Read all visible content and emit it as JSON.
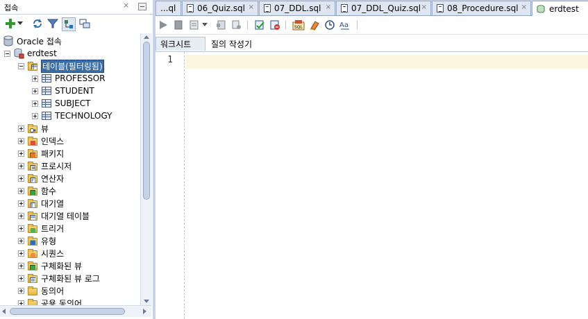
{
  "left_pane": {
    "title": "접속",
    "close_glyph": "×",
    "toolbar": [
      {
        "name": "add-connection-icon"
      },
      {
        "name": "dropdown-arrow-icon"
      },
      {
        "name": "refresh-icon"
      },
      {
        "name": "filter-icon"
      },
      {
        "name": "schema-browser-icon"
      },
      {
        "name": "manage-connections-icon"
      }
    ]
  },
  "tree": {
    "root": {
      "label": "Oracle 접속"
    },
    "connection": {
      "label": "erdtest"
    },
    "tables_folder": {
      "label": "테이블(필터링됨)"
    },
    "tables": [
      {
        "label": "PROFESSOR"
      },
      {
        "label": "STUDENT"
      },
      {
        "label": "SUBJECT"
      },
      {
        "label": "TECHNOLOGY"
      }
    ],
    "folders": [
      {
        "label": "뷰",
        "badge": "view"
      },
      {
        "label": "인덱스",
        "badge": "index"
      },
      {
        "label": "패키지",
        "badge": "package"
      },
      {
        "label": "프로시저",
        "badge": "procedure"
      },
      {
        "label": "연산자",
        "badge": "operator"
      },
      {
        "label": "함수",
        "badge": "function"
      },
      {
        "label": "대기열",
        "badge": "queue"
      },
      {
        "label": "대기열 테이블",
        "badge": "queue-table"
      },
      {
        "label": "트리거",
        "badge": "trigger"
      },
      {
        "label": "유형",
        "badge": "type"
      },
      {
        "label": "시퀀스",
        "badge": "sequence"
      },
      {
        "label": "구체화된 뷰",
        "badge": "mview"
      },
      {
        "label": "구체화된 뷰 로그",
        "badge": "mview-log"
      },
      {
        "label": "동의어",
        "badge": "synonym"
      },
      {
        "label": "공용 동의어",
        "badge": "public-synonym"
      }
    ]
  },
  "editor_tabs": [
    {
      "label": "...ql",
      "icon": "sql-file-icon"
    },
    {
      "label": "06_Quiz.sql",
      "icon": "sql-file-icon"
    },
    {
      "label": "07_DDL.sql",
      "icon": "sql-file-icon"
    },
    {
      "label": "07_DDL_Quiz.sql",
      "icon": "sql-file-icon"
    },
    {
      "label": "08_Procedure.sql",
      "icon": "sql-file-icon"
    },
    {
      "label": "erdtest",
      "icon": "db-connection-icon",
      "active": true
    }
  ],
  "tab_close_glyph": "×",
  "editor_toolbar": [
    {
      "name": "run-statement-icon"
    },
    {
      "name": "run-script-icon"
    },
    {
      "name": "explain-plan-icon"
    },
    {
      "name": "explain-dropdown-icon"
    },
    {
      "name": "autotrace-icon"
    },
    {
      "name": "sql-tuning-icon"
    },
    {
      "name": "commit-icon"
    },
    {
      "name": "rollback-icon"
    },
    {
      "name": "unshared-sql-icon"
    },
    {
      "name": "clear-icon"
    },
    {
      "name": "sql-history-icon"
    },
    {
      "name": "format-case-icon"
    }
  ],
  "subtabs": [
    {
      "label": "워크시트",
      "active": true
    },
    {
      "label": "질의 작성기",
      "active": false
    }
  ],
  "editor": {
    "line_number": "1",
    "content": ""
  },
  "colors": {
    "tab_bar": "#c5d1e6",
    "selection": "#3b6ea5",
    "current_line": "#fdf6df"
  }
}
